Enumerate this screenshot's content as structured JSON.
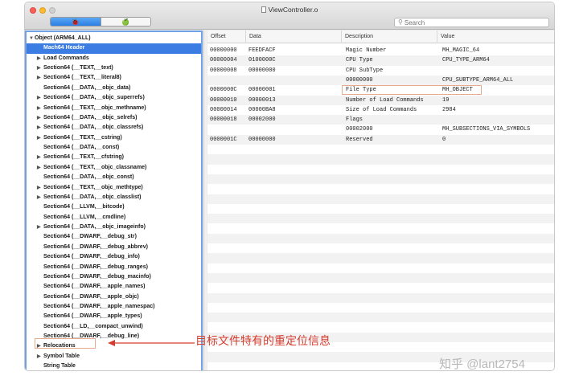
{
  "window": {
    "title": "ViewController.o"
  },
  "search": {
    "placeholder": "Search"
  },
  "segment": {
    "left_label": "🐞",
    "right_label": "🍏"
  },
  "sidebar": {
    "items": [
      {
        "label": "Object (ARM64_ALL)",
        "expand": "▼",
        "root": true
      },
      {
        "label": "Mach64 Header",
        "expand": "",
        "selected": true
      },
      {
        "label": "Load Commands",
        "expand": "▶"
      },
      {
        "label": "Section64 (__TEXT,__text)",
        "expand": "▶"
      },
      {
        "label": "Section64 (__TEXT,__literal8)",
        "expand": "▶"
      },
      {
        "label": "Section64 (__DATA,__objc_data)",
        "expand": ""
      },
      {
        "label": "Section64 (__DATA,__objc_superrefs)",
        "expand": "▶"
      },
      {
        "label": "Section64 (__TEXT,__objc_methname)",
        "expand": "▶"
      },
      {
        "label": "Section64 (__DATA,__objc_selrefs)",
        "expand": "▶"
      },
      {
        "label": "Section64 (__DATA,__objc_classrefs)",
        "expand": "▶"
      },
      {
        "label": "Section64 (__TEXT,__cstring)",
        "expand": "▶"
      },
      {
        "label": "Section64 (__DATA,__const)",
        "expand": ""
      },
      {
        "label": "Section64 (__TEXT,__cfstring)",
        "expand": "▶"
      },
      {
        "label": "Section64 (__TEXT,__objc_classname)",
        "expand": "▶"
      },
      {
        "label": "Section64 (__DATA,__objc_const)",
        "expand": ""
      },
      {
        "label": "Section64 (__TEXT,__objc_methtype)",
        "expand": "▶"
      },
      {
        "label": "Section64 (__DATA,__objc_classlist)",
        "expand": "▶"
      },
      {
        "label": "Section64 (__LLVM,__bitcode)",
        "expand": ""
      },
      {
        "label": "Section64 (__LLVM,__cmdline)",
        "expand": ""
      },
      {
        "label": "Section64 (__DATA,__objc_imageinfo)",
        "expand": "▶"
      },
      {
        "label": "Section64 (__DWARF,__debug_str)",
        "expand": ""
      },
      {
        "label": "Section64 (__DWARF,__debug_abbrev)",
        "expand": ""
      },
      {
        "label": "Section64 (__DWARF,__debug_info)",
        "expand": ""
      },
      {
        "label": "Section64 (__DWARF,__debug_ranges)",
        "expand": ""
      },
      {
        "label": "Section64 (__DWARF,__debug_macinfo)",
        "expand": ""
      },
      {
        "label": "Section64 (__DWARF,__apple_names)",
        "expand": ""
      },
      {
        "label": "Section64 (__DWARF,__apple_objc)",
        "expand": ""
      },
      {
        "label": "Section64 (__DWARF,__apple_namespac)",
        "expand": ""
      },
      {
        "label": "Section64 (__DWARF,__apple_types)",
        "expand": ""
      },
      {
        "label": "Section64 (__LD,__compact_unwind)",
        "expand": ""
      },
      {
        "label": "Section64 (__DWARF,__debug_line)",
        "expand": ""
      },
      {
        "label": "Relocations",
        "expand": "▶"
      },
      {
        "label": "Symbol Table",
        "expand": "▶"
      },
      {
        "label": "String Table",
        "expand": ""
      }
    ]
  },
  "table": {
    "columns": [
      "Offset",
      "Data",
      "Description",
      "Value"
    ],
    "rows": [
      [
        "00000000",
        "FEEDFACF",
        "Magic Number",
        "MH_MAGIC_64"
      ],
      [
        "00000004",
        "0100000C",
        "CPU Type",
        "CPU_TYPE_ARM64"
      ],
      [
        "00000008",
        "00000000",
        "CPU SubType",
        ""
      ],
      [
        "",
        "",
        "00000000",
        "CPU_SUBTYPE_ARM64_ALL"
      ],
      [
        "0000000C",
        "00000001",
        "File Type",
        "MH_OBJECT"
      ],
      [
        "00000010",
        "00000013",
        "Number of Load Commands",
        "19"
      ],
      [
        "00000014",
        "00000BA8",
        "Size of Load Commands",
        "2984"
      ],
      [
        "00000018",
        "00002000",
        "Flags",
        ""
      ],
      [
        "",
        "",
        "00002000",
        "MH_SUBSECTIONS_VIA_SYMBOLS"
      ],
      [
        "0000001C",
        "00000000",
        "Reserved",
        "0"
      ]
    ]
  },
  "annotation": {
    "text": "目标文件特有的重定位信息"
  },
  "watermark": {
    "text": "知乎 @lant2754"
  },
  "colors": {
    "selection": "#3b7de2",
    "annotation": "#d63c2e",
    "highlight_box": "#e9a98a"
  }
}
